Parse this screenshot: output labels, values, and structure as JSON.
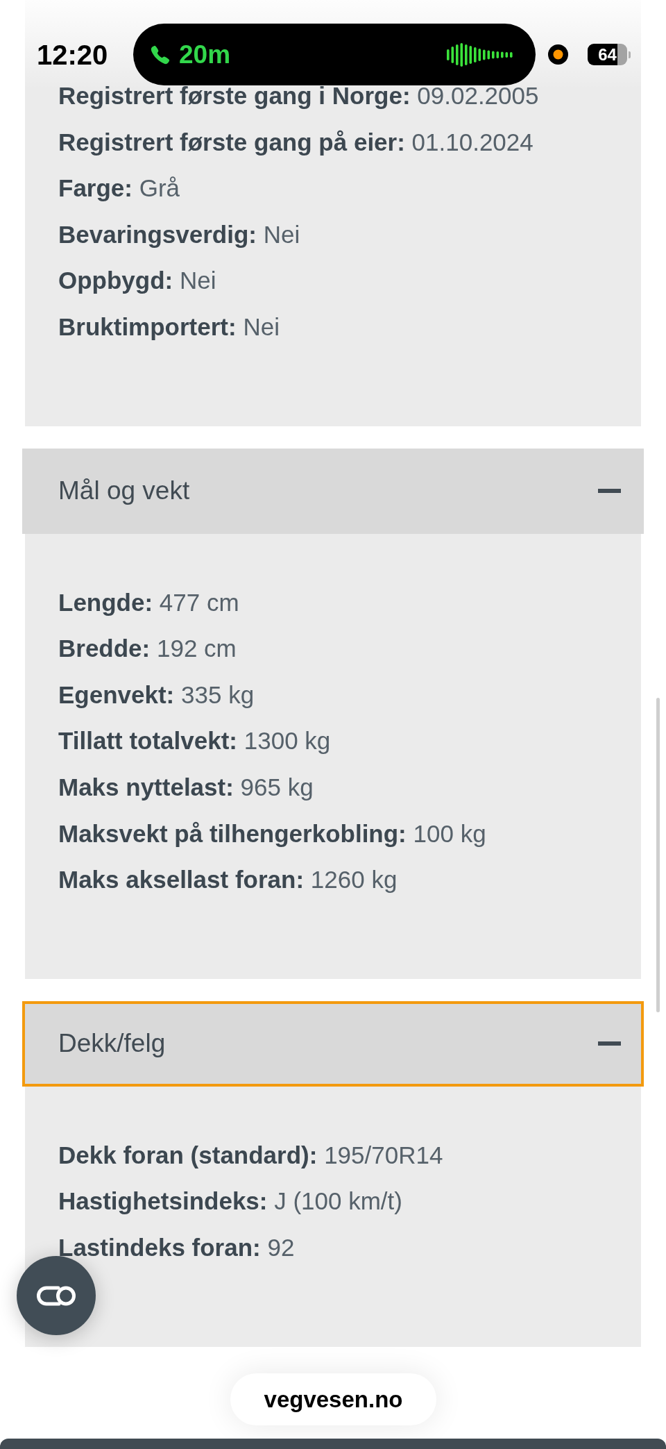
{
  "status_bar": {
    "time": "12:20",
    "call_duration": "20m",
    "battery": "64"
  },
  "sections": [
    {
      "expanded": true,
      "rows": [
        {
          "label": "Registrert første gang i Norge:",
          "value": "09.02.2005"
        },
        {
          "label": "Registrert første gang på eier:",
          "value": "01.10.2024"
        },
        {
          "label": "Farge:",
          "value": "Grå"
        },
        {
          "label": "Bevaringsverdig:",
          "value": "Nei"
        },
        {
          "label": "Oppbygd:",
          "value": "Nei"
        },
        {
          "label": "Bruktimportert:",
          "value": "Nei"
        }
      ]
    },
    {
      "title": "Mål og vekt",
      "expanded": true,
      "focused": false,
      "rows": [
        {
          "label": "Lengde:",
          "value": "477 cm"
        },
        {
          "label": "Bredde:",
          "value": "192 cm"
        },
        {
          "label": "Egenvekt:",
          "value": "335 kg"
        },
        {
          "label": "Tillatt totalvekt:",
          "value": "1300 kg"
        },
        {
          "label": "Maks nyttelast:",
          "value": "965 kg"
        },
        {
          "label": "Maksvekt på tilhengerkobling:",
          "value": "100 kg"
        },
        {
          "label": "Maks aksellast foran:",
          "value": "1260 kg"
        }
      ]
    },
    {
      "title": "Dekk/felg",
      "expanded": true,
      "focused": true,
      "rows": [
        {
          "label": "Dekk foran (standard):",
          "value": "195/70R14"
        },
        {
          "label": "Hastighetsindeks:",
          "value": "J (100 km/t)"
        },
        {
          "label": "Lastindeks foran:",
          "value": "92"
        }
      ]
    }
  ],
  "address_bar": {
    "url": "vegvesen.no"
  }
}
